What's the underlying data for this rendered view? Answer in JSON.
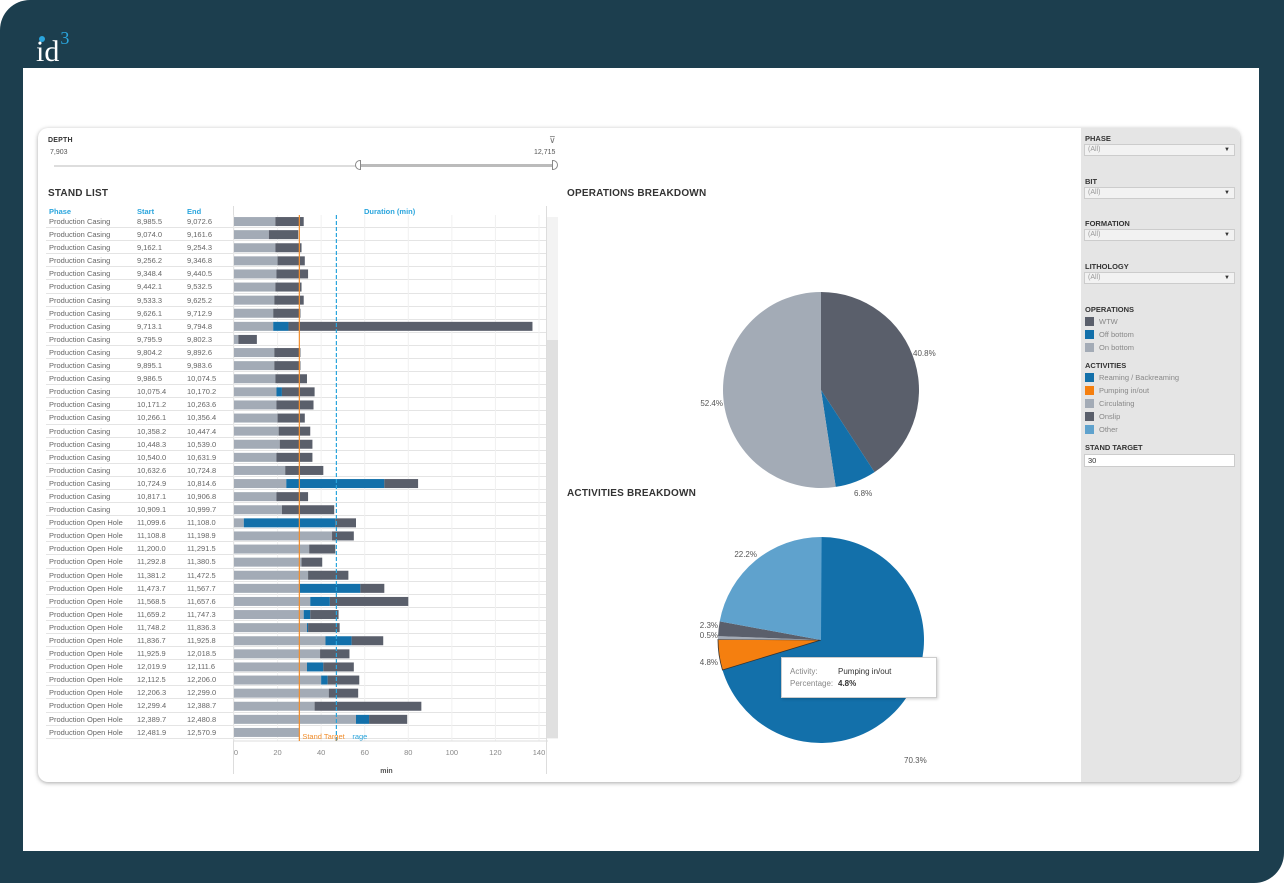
{
  "brand": {
    "logo_text": "id",
    "logo_sup": "3"
  },
  "depth_filter": {
    "title": "DEPTH",
    "min": "7,903",
    "max": "12,715",
    "clear_icon": "filter-clear-icon",
    "range_low_fraction": 0.6,
    "range_high_fraction": 1.0
  },
  "stand_list": {
    "title": "STAND LIST",
    "columns": {
      "phase": "Phase",
      "start": "Start",
      "end": "End",
      "duration": "Duration (min)"
    },
    "rows": [
      {
        "phase": "Production Casing",
        "start": "8,985.5",
        "end": "9,072.6"
      },
      {
        "phase": "Production Casing",
        "start": "9,074.0",
        "end": "9,161.6"
      },
      {
        "phase": "Production Casing",
        "start": "9,162.1",
        "end": "9,254.3"
      },
      {
        "phase": "Production Casing",
        "start": "9,256.2",
        "end": "9,346.8"
      },
      {
        "phase": "Production Casing",
        "start": "9,348.4",
        "end": "9,440.5"
      },
      {
        "phase": "Production Casing",
        "start": "9,442.1",
        "end": "9,532.5"
      },
      {
        "phase": "Production Casing",
        "start": "9,533.3",
        "end": "9,625.2"
      },
      {
        "phase": "Production Casing",
        "start": "9,626.1",
        "end": "9,712.9"
      },
      {
        "phase": "Production Casing",
        "start": "9,713.1",
        "end": "9,794.8"
      },
      {
        "phase": "Production Casing",
        "start": "9,795.9",
        "end": "9,802.3"
      },
      {
        "phase": "Production Casing",
        "start": "9,804.2",
        "end": "9,892.6"
      },
      {
        "phase": "Production Casing",
        "start": "9,895.1",
        "end": "9,983.6"
      },
      {
        "phase": "Production Casing",
        "start": "9,986.5",
        "end": "10,074.5"
      },
      {
        "phase": "Production Casing",
        "start": "10,075.4",
        "end": "10,170.2"
      },
      {
        "phase": "Production Casing",
        "start": "10,171.2",
        "end": "10,263.6"
      },
      {
        "phase": "Production Casing",
        "start": "10,266.1",
        "end": "10,356.4"
      },
      {
        "phase": "Production Casing",
        "start": "10,358.2",
        "end": "10,447.4"
      },
      {
        "phase": "Production Casing",
        "start": "10,448.3",
        "end": "10,539.0"
      },
      {
        "phase": "Production Casing",
        "start": "10,540.0",
        "end": "10,631.9"
      },
      {
        "phase": "Production Casing",
        "start": "10,632.6",
        "end": "10,724.8"
      },
      {
        "phase": "Production Casing",
        "start": "10,724.9",
        "end": "10,814.6"
      },
      {
        "phase": "Production Casing",
        "start": "10,817.1",
        "end": "10,906.8"
      },
      {
        "phase": "Production Casing",
        "start": "10,909.1",
        "end": "10,999.7"
      },
      {
        "phase": "Production Open Hole",
        "start": "11,099.6",
        "end": "11,108.0"
      },
      {
        "phase": "Production Open Hole",
        "start": "11,108.8",
        "end": "11,198.9"
      },
      {
        "phase": "Production Open Hole",
        "start": "11,200.0",
        "end": "11,291.5"
      },
      {
        "phase": "Production Open Hole",
        "start": "11,292.8",
        "end": "11,380.5"
      },
      {
        "phase": "Production Open Hole",
        "start": "11,381.2",
        "end": "11,472.5"
      },
      {
        "phase": "Production Open Hole",
        "start": "11,473.7",
        "end": "11,567.7"
      },
      {
        "phase": "Production Open Hole",
        "start": "11,568.5",
        "end": "11,657.6"
      },
      {
        "phase": "Production Open Hole",
        "start": "11,659.2",
        "end": "11,747.3"
      },
      {
        "phase": "Production Open Hole",
        "start": "11,748.2",
        "end": "11,836.3"
      },
      {
        "phase": "Production Open Hole",
        "start": "11,836.7",
        "end": "11,925.8"
      },
      {
        "phase": "Production Open Hole",
        "start": "11,925.9",
        "end": "12,018.5"
      },
      {
        "phase": "Production Open Hole",
        "start": "12,019.9",
        "end": "12,111.6"
      },
      {
        "phase": "Production Open Hole",
        "start": "12,112.5",
        "end": "12,206.0"
      },
      {
        "phase": "Production Open Hole",
        "start": "12,206.3",
        "end": "12,299.0"
      },
      {
        "phase": "Production Open Hole",
        "start": "12,299.4",
        "end": "12,388.7"
      },
      {
        "phase": "Production Open Hole",
        "start": "12,389.7",
        "end": "12,480.8"
      },
      {
        "phase": "Production Open Hole",
        "start": "12,481.9",
        "end": "12,570.9"
      }
    ]
  },
  "operations_legend": {
    "title": "OPERATIONS",
    "items": [
      {
        "label": "WTW",
        "color": "#5a5f6b"
      },
      {
        "label": "Off bottom",
        "color": "#1370aa"
      },
      {
        "label": "On bottom",
        "color": "#a3abb6"
      }
    ]
  },
  "activities_legend": {
    "title": "ACTIVITIES",
    "items": [
      {
        "label": "Reaming / Backreaming",
        "color": "#1370aa"
      },
      {
        "label": "Pumping in/out",
        "color": "#f57f0f"
      },
      {
        "label": "Circulating",
        "color": "#a3abb6"
      },
      {
        "label": "Onslip",
        "color": "#5a5f6b"
      },
      {
        "label": "Other",
        "color": "#5fa2cd"
      }
    ]
  },
  "filters": [
    {
      "label": "PHASE",
      "value": "(All)"
    },
    {
      "label": "BIT",
      "value": "(All)"
    },
    {
      "label": "FORMATION",
      "value": "(All)"
    },
    {
      "label": "LITHOLOGY",
      "value": "(All)"
    }
  ],
  "stand_target": {
    "label": "STAND TARGET",
    "value": "30"
  },
  "tooltip": {
    "activity_key": "Activity:",
    "activity_value": "Pumping in/out",
    "pct_key": "Percentage:",
    "pct_value": "4.8%"
  },
  "chart_data": [
    {
      "type": "bar",
      "orientation": "horizontal-stacked",
      "title": "Duration (min)",
      "xlabel": "min",
      "xlim": [
        0,
        140
      ],
      "xticks": [
        "0",
        "20",
        "40",
        "60",
        "80",
        "100",
        "120",
        "140"
      ],
      "reference_lines": [
        {
          "name": "Stand Target",
          "value": 30,
          "color": "#f28e2b",
          "style": "solid",
          "label": "Stand Target"
        },
        {
          "name": "Average",
          "value": 47,
          "color": "#2aa5dd",
          "style": "dashed",
          "label": "rage"
        }
      ],
      "series_order": [
        "On bottom",
        "Off bottom",
        "WTW"
      ],
      "colors": {
        "On bottom": "#a3abb6",
        "Off bottom": "#1370aa",
        "WTW": "#5a5f6b"
      },
      "bars": [
        [
          19,
          0,
          13
        ],
        [
          16,
          0,
          13.5
        ],
        [
          19,
          0,
          12
        ],
        [
          20,
          0,
          12.5
        ],
        [
          19.5,
          0,
          14.5
        ],
        [
          19,
          0,
          12
        ],
        [
          18.5,
          0,
          13.5
        ],
        [
          18,
          0,
          12.5
        ],
        [
          18,
          7,
          112
        ],
        [
          2,
          0,
          8.5
        ],
        [
          18.5,
          0,
          12
        ],
        [
          18.5,
          0,
          12
        ],
        [
          19,
          0,
          14.5
        ],
        [
          19.5,
          2.5,
          15
        ],
        [
          19.5,
          0,
          17
        ],
        [
          20,
          0,
          12.5
        ],
        [
          20.5,
          0,
          14.5
        ],
        [
          21,
          0,
          15
        ],
        [
          19.5,
          0,
          16.5
        ],
        [
          23.5,
          0,
          17.5
        ],
        [
          24,
          45,
          15.5
        ],
        [
          19.5,
          0,
          14.5
        ],
        [
          22,
          0,
          24
        ],
        [
          4.5,
          42,
          9.5
        ],
        [
          45,
          0,
          10
        ],
        [
          34.5,
          0,
          12
        ],
        [
          31,
          0,
          9.5
        ],
        [
          34,
          0,
          18.5
        ],
        [
          30,
          28,
          11
        ],
        [
          35,
          9,
          36
        ],
        [
          32,
          3,
          13
        ],
        [
          33.5,
          0.5,
          14.5
        ],
        [
          42,
          12,
          14.5
        ],
        [
          39.5,
          0,
          13.5
        ],
        [
          33.5,
          7.5,
          14
        ],
        [
          40,
          3,
          14.5
        ],
        [
          43.5,
          0,
          13.5
        ],
        [
          37,
          0,
          49
        ],
        [
          56,
          6,
          17.5
        ],
        [
          30,
          0,
          0
        ]
      ]
    },
    {
      "type": "pie",
      "title": "OPERATIONS BREAKDOWN",
      "slices": [
        {
          "label": "WTW",
          "value": 40.8,
          "color": "#5a5f6b"
        },
        {
          "label": "Off bottom",
          "value": 6.8,
          "color": "#1370aa"
        },
        {
          "label": "On bottom",
          "value": 52.4,
          "color": "#a3abb6"
        }
      ]
    },
    {
      "type": "pie",
      "title": "ACTIVITIES BREAKDOWN",
      "slices": [
        {
          "label": "Reaming / Backreaming",
          "value": 70.3,
          "color": "#1370aa"
        },
        {
          "label": "Pumping in/out",
          "value": 4.8,
          "color": "#f57f0f",
          "highlighted": true
        },
        {
          "label": "Circulating",
          "value": 0.5,
          "color": "#a3abb6"
        },
        {
          "label": "Onslip",
          "value": 2.3,
          "color": "#5a5f6b"
        },
        {
          "label": "Other",
          "value": 22.2,
          "color": "#5fa2cd"
        }
      ]
    }
  ]
}
